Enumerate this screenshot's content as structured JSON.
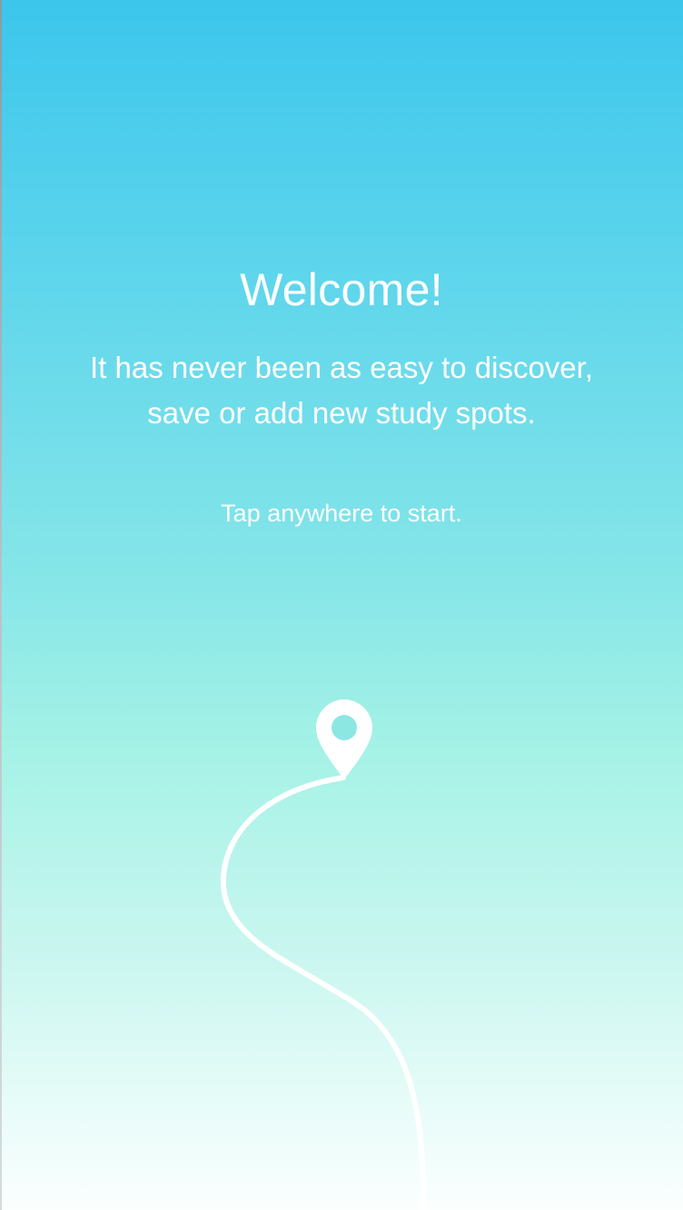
{
  "welcome": {
    "title": "Welcome!",
    "subtitle_line1": "It has never been as easy to discover,",
    "subtitle_line2": "save or add new study spots.",
    "hint": "Tap anywhere to start."
  },
  "icons": {
    "pin": "map-pin-icon",
    "route": "route-path"
  },
  "colors": {
    "gradient_top": "#3cc6ec",
    "gradient_mid": "#a5f2e6",
    "gradient_bottom": "#fbfffe",
    "text": "#ffffff"
  }
}
